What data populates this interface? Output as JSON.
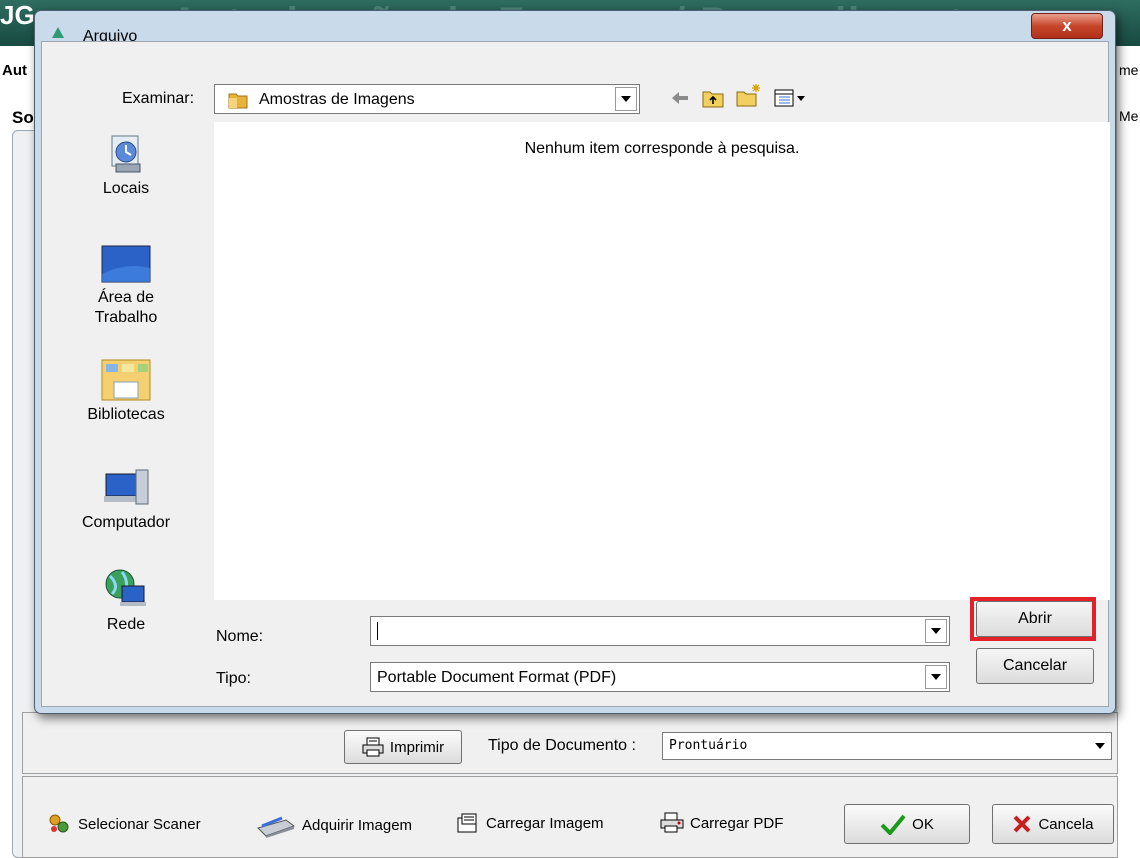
{
  "app": {
    "logo": "JG",
    "title": "Autorização de Exames / Procedimentos",
    "left_fragments": [
      "Aut",
      "So"
    ],
    "right_fragments": [
      "me",
      "Me"
    ]
  },
  "dialog": {
    "title": "Arquivo",
    "close_label": "x",
    "look_in_label": "Examinar:",
    "look_in_value": "Amostras de Imagens",
    "empty_message": "Nenhum item corresponde à pesquisa.",
    "places": [
      {
        "label": "Locais",
        "icon": "recent-places-icon"
      },
      {
        "label": "Área de Trabalho",
        "icon": "desktop-icon"
      },
      {
        "label": "Bibliotecas",
        "icon": "libraries-icon"
      },
      {
        "label": "Computador",
        "icon": "computer-icon"
      },
      {
        "label": "Rede",
        "icon": "network-icon"
      }
    ],
    "name_label": "Nome:",
    "name_value": "",
    "type_label": "Tipo:",
    "type_value": "Portable Document Format (PDF)",
    "open_label": "Abrir",
    "cancel_label": "Cancelar"
  },
  "form": {
    "print_label": "Imprimir",
    "doc_type_label": "Tipo de Documento :",
    "doc_type_value": "Prontuário"
  },
  "footer": {
    "select_scanner": "Selecionar Scaner",
    "acquire_image": "Adquirir Imagem",
    "load_image": "Carregar Imagem",
    "load_pdf": "Carregar PDF",
    "ok": "OK",
    "cancel": "Cancela"
  },
  "colors": {
    "highlight": "#e3212a",
    "close_button": "#c7462b",
    "dialog_frame": "#c9dbea"
  }
}
